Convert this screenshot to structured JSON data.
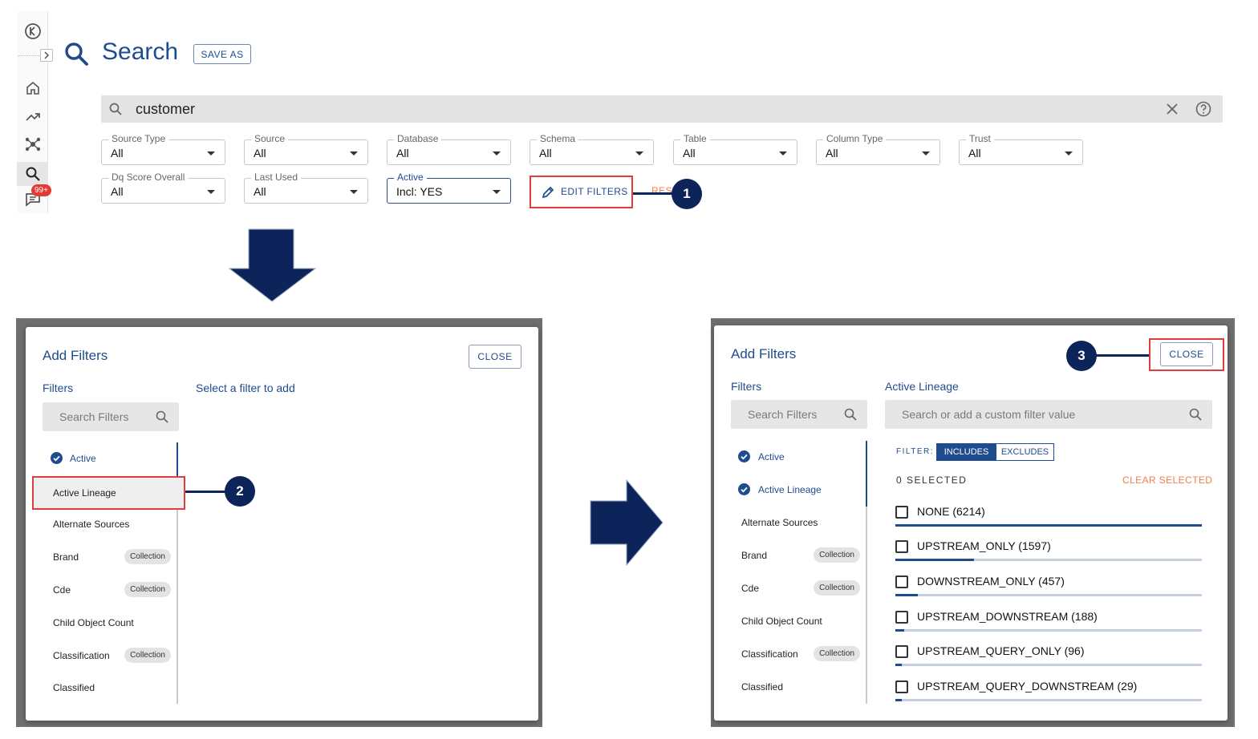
{
  "search_screen": {
    "title": "Search",
    "save_as_label": "SAVE AS",
    "query": "customer",
    "notification_badge": "99+",
    "dropdowns": [
      {
        "label": "Source Type",
        "value": "All"
      },
      {
        "label": "Source",
        "value": "All"
      },
      {
        "label": "Database",
        "value": "All"
      },
      {
        "label": "Schema",
        "value": "All"
      },
      {
        "label": "Table",
        "value": "All"
      },
      {
        "label": "Column Type",
        "value": "All"
      },
      {
        "label": "Trust",
        "value": "All"
      },
      {
        "label": "Dq Score Overall",
        "value": "All"
      },
      {
        "label": "Last Used",
        "value": "All"
      },
      {
        "label": "Active",
        "value": "Incl: YES"
      }
    ],
    "edit_filters_label": "EDIT FILTERS",
    "reset_peek": "RESE",
    "icons": [
      "kada-logo-icon",
      "chevron-right-icon",
      "home-icon",
      "trend-icon",
      "network-icon",
      "search-icon",
      "chat-icon",
      "clear-icon",
      "help-icon",
      "pencil-icon"
    ]
  },
  "callouts": {
    "one": "1",
    "two": "2",
    "three": "3"
  },
  "colors": {
    "brand": "#1f4b8f",
    "callout": "#0c2459",
    "highlight": "#e23c3c",
    "accent_orange": "#f07f4a"
  },
  "dialog_left": {
    "title": "Add Filters",
    "close_label": "CLOSE",
    "filters_heading": "Filters",
    "right_heading": "Select a filter to add",
    "search_placeholder": "Search Filters",
    "items": [
      {
        "label": "Active",
        "checked": true,
        "tag": ""
      },
      {
        "label": "Active Lineage",
        "checked": false,
        "tag": ""
      },
      {
        "label": "Alternate Sources",
        "checked": false,
        "tag": ""
      },
      {
        "label": "Brand",
        "checked": false,
        "tag": "Collection"
      },
      {
        "label": "Cde",
        "checked": false,
        "tag": "Collection"
      },
      {
        "label": "Child Object Count",
        "checked": false,
        "tag": ""
      },
      {
        "label": "Classification",
        "checked": false,
        "tag": "Collection"
      },
      {
        "label": "Classified",
        "checked": false,
        "tag": ""
      }
    ]
  },
  "dialog_right": {
    "title": "Add Filters",
    "close_label": "CLOSE",
    "filters_heading": "Filters",
    "right_heading": "Active Lineage",
    "search_placeholder": "Search Filters",
    "value_search_placeholder": "Search or add a custom filter value",
    "filter_label": "FILTER:",
    "includes_label": "INCLUDES",
    "excludes_label": "EXCLUDES",
    "selected_count": "0 SELECTED",
    "clear_selected": "CLEAR SELECTED",
    "items": [
      {
        "label": "Active",
        "checked": true,
        "tag": ""
      },
      {
        "label": "Active Lineage",
        "checked": true,
        "tag": ""
      },
      {
        "label": "Alternate Sources",
        "checked": false,
        "tag": ""
      },
      {
        "label": "Brand",
        "checked": false,
        "tag": "Collection"
      },
      {
        "label": "Cde",
        "checked": false,
        "tag": "Collection"
      },
      {
        "label": "Child Object Count",
        "checked": false,
        "tag": ""
      },
      {
        "label": "Classification",
        "checked": false,
        "tag": "Collection"
      },
      {
        "label": "Classified",
        "checked": false,
        "tag": ""
      }
    ],
    "values": [
      {
        "label": "NONE (6214)",
        "share": 1.0
      },
      {
        "label": "UPSTREAM_ONLY (1597)",
        "share": 0.257
      },
      {
        "label": "DOWNSTREAM_ONLY (457)",
        "share": 0.074
      },
      {
        "label": "UPSTREAM_DOWNSTREAM (188)",
        "share": 0.03
      },
      {
        "label": "UPSTREAM_QUERY_ONLY (96)",
        "share": 0.015
      },
      {
        "label": "UPSTREAM_QUERY_DOWNSTREAM (29)",
        "share": 0.005
      }
    ]
  }
}
